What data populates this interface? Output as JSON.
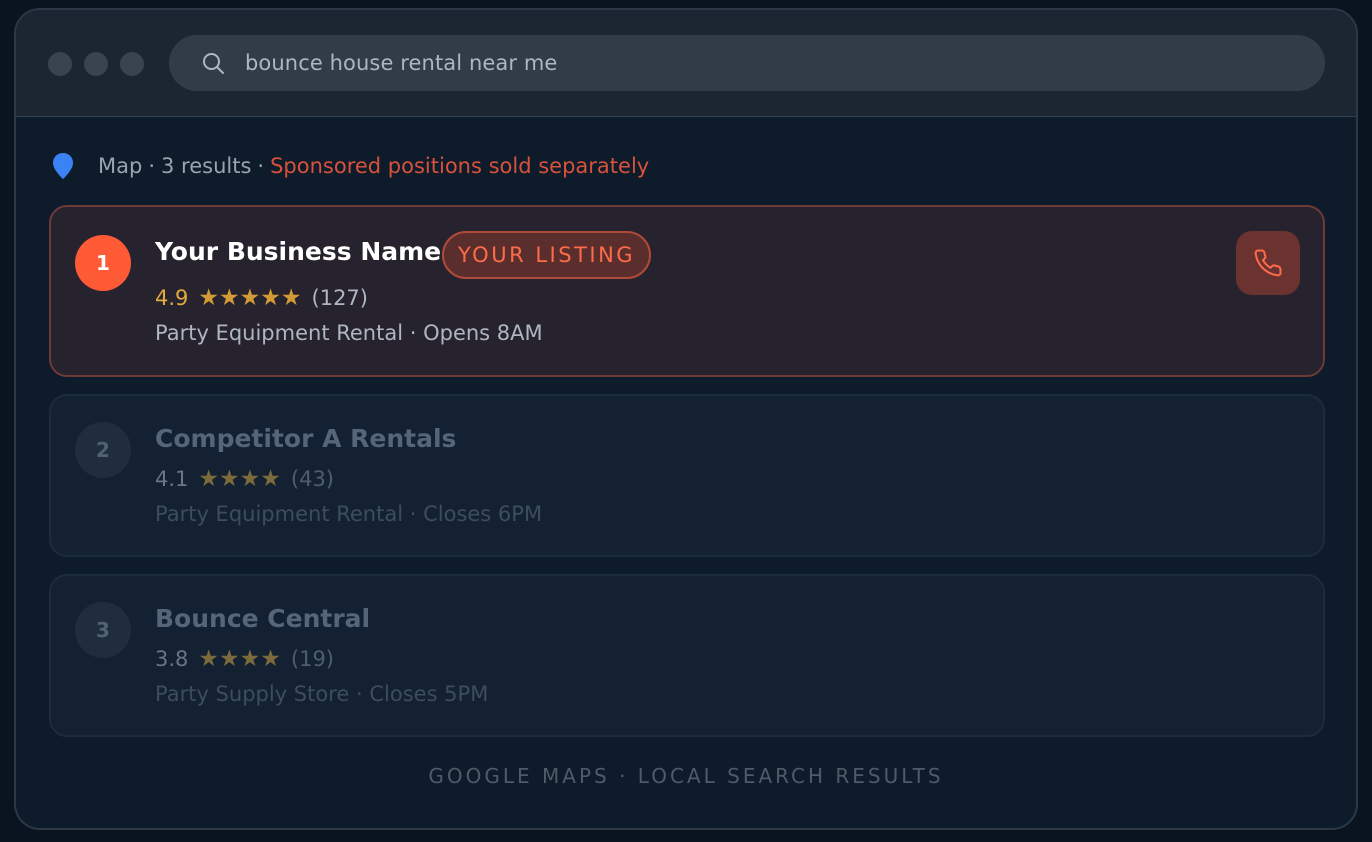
{
  "search": {
    "query": "bounce house rental near me"
  },
  "meta": {
    "source": "Map",
    "count": "3 results",
    "sponsored": "Sponsored positions sold separately"
  },
  "colors": {
    "accent": "#ff5a36",
    "star": "#d39a35",
    "pin": "#3b82f6",
    "sponsored": "#d8523b"
  },
  "listings": [
    {
      "rank": "1",
      "name": "Your Business Name",
      "badge": "YOUR LISTING",
      "rating": "4.9",
      "stars": "★★★★★",
      "reviews": "(127)",
      "category": "Party Equipment Rental",
      "hours": "Opens 8AM",
      "action_icon": "phone-icon"
    },
    {
      "rank": "2",
      "name": "Competitor A Rentals",
      "rating": "4.1",
      "stars": "★★★★",
      "reviews": "(43)",
      "category": "Party Equipment Rental",
      "hours": "Closes 6PM"
    },
    {
      "rank": "3",
      "name": "Bounce Central",
      "rating": "3.8",
      "stars": "★★★★",
      "reviews": "(19)",
      "category": "Party Supply Store",
      "hours": "Closes 5PM"
    }
  ],
  "footer": "GOOGLE MAPS · LOCAL SEARCH RESULTS"
}
